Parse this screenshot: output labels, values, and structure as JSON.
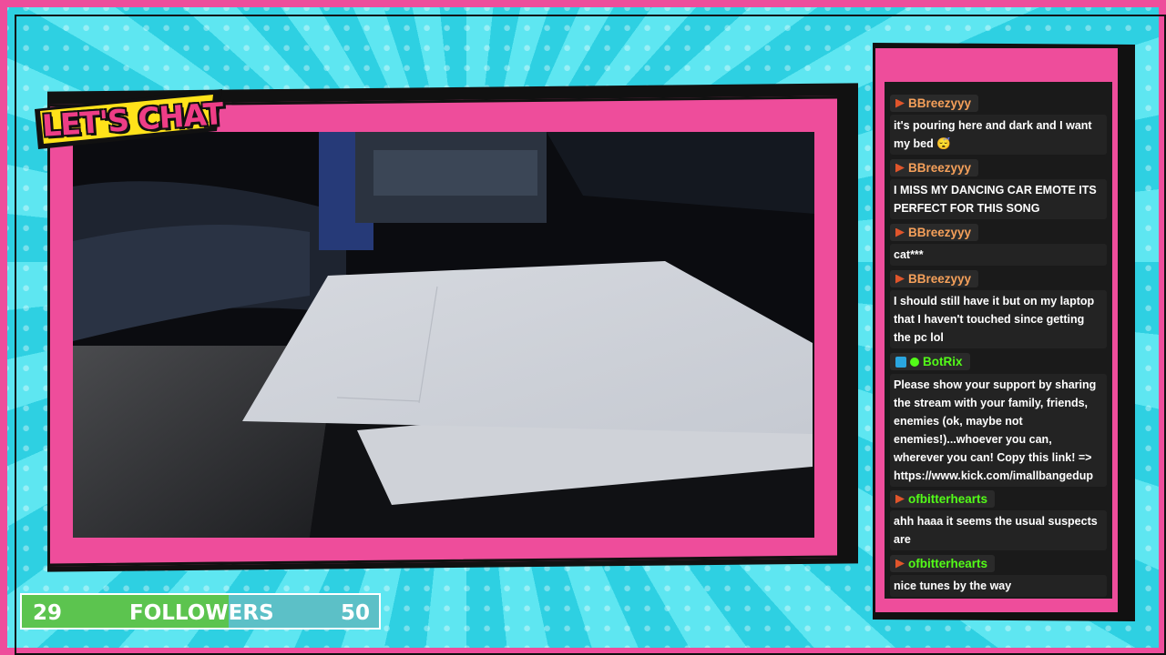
{
  "overlay": {
    "badge_text": "LET'S CHAT",
    "accent_color": "#ee4d9b",
    "background_color": "#3ad6e6"
  },
  "followers": {
    "current": "29",
    "label": "FOLLOWERS",
    "goal": "50",
    "progress_fraction": 0.58
  },
  "chat": {
    "messages": [
      {
        "user": "BBreezyyy",
        "user_color": "#f5a05a",
        "badge": "kick",
        "text": "it's pouring here and dark and I want my bed 😴"
      },
      {
        "user": "BBreezyyy",
        "user_color": "#f5a05a",
        "badge": "kick",
        "text": "I MISS MY DANCING CAR EMOTE ITS PERFECT FOR THIS SONG"
      },
      {
        "user": "BBreezyyy",
        "user_color": "#f5a05a",
        "badge": "kick",
        "text": "cat***"
      },
      {
        "user": "BBreezyyy",
        "user_color": "#f5a05a",
        "badge": "kick",
        "text": "I should still have it but on my laptop that I haven't touched since getting the pc lol"
      },
      {
        "user": "BotRix",
        "user_color": "#53fc18",
        "badge": "bot",
        "text": "Please show your support by sharing the stream with your family, friends, enemies (ok, maybe not enemies!)...whoever you can, wherever you can! Copy this link! => https://www.kick.com/imallbangedup"
      },
      {
        "user": "ofbitterhearts",
        "user_color": "#53fc18",
        "badge": "kick",
        "text": "ahh haaa it seems the usual suspects are"
      },
      {
        "user": "ofbitterhearts",
        "user_color": "#53fc18",
        "badge": "kick",
        "text": "nice tunes by the way"
      }
    ]
  }
}
